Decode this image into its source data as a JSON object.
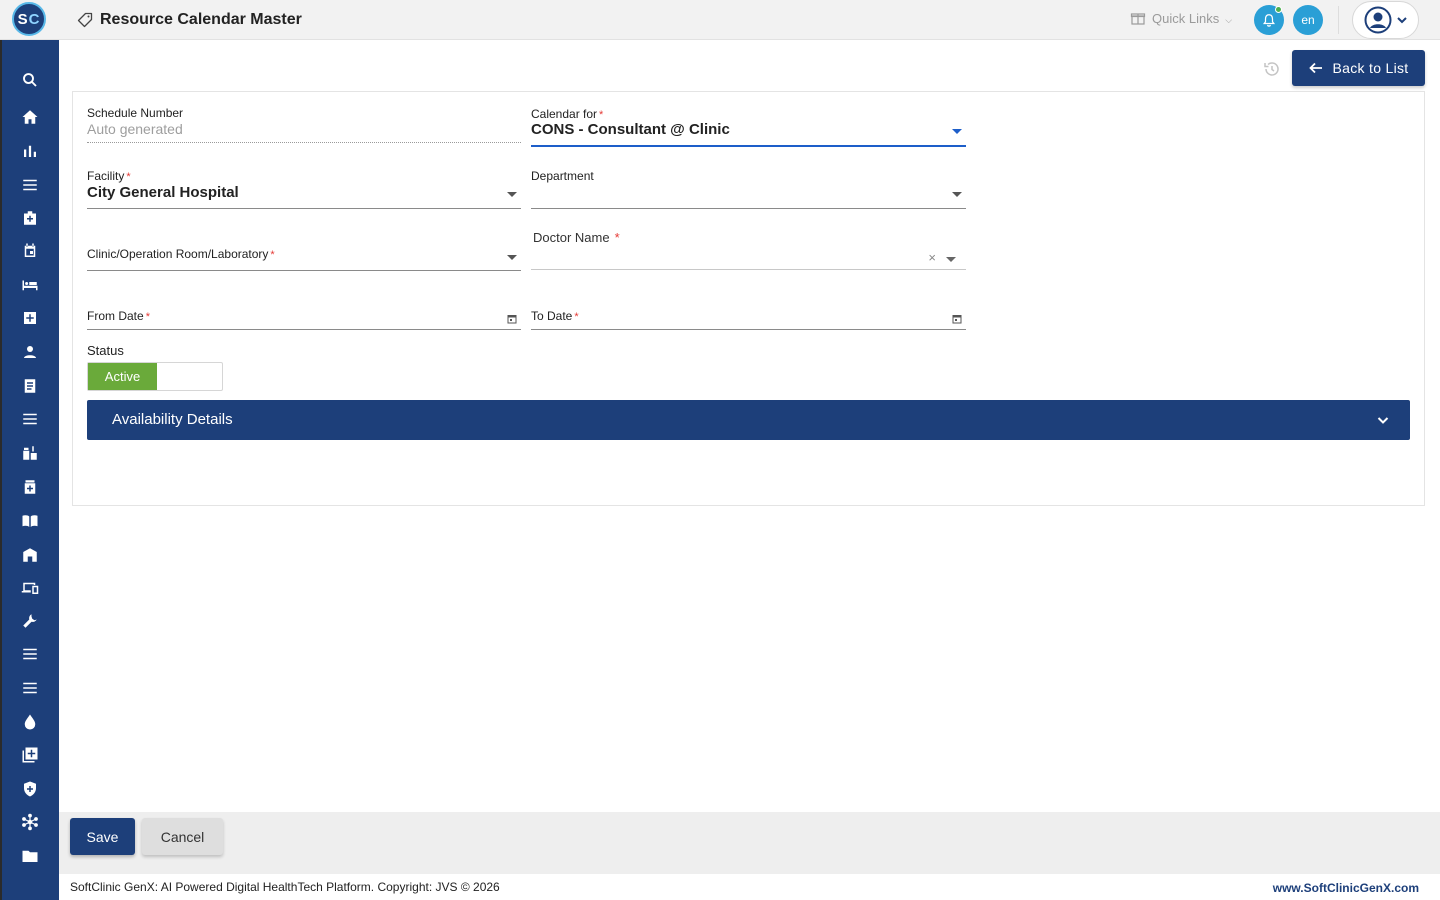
{
  "app": {
    "logo_text_s": "S",
    "logo_text_c": "C",
    "page_title": "Resource Calendar Master",
    "quick_links": "Quick Links",
    "language": "en"
  },
  "sidebar": {
    "items": [
      "search-icon",
      "home-icon",
      "bar-chart-icon",
      "menu-icon",
      "medical-bag-icon",
      "calendar-icon",
      "bed-icon",
      "medical-plus-icon",
      "person-icon",
      "receipt-icon",
      "menu-icon",
      "pharmacy-icon",
      "pill-box-icon",
      "book-icon",
      "store-icon",
      "devices-icon",
      "wrench-icon",
      "menu-icon",
      "menu-icon",
      "blood-drop-icon",
      "library-add-icon",
      "shield-icon",
      "network-icon",
      "folder-icon"
    ]
  },
  "toolbar": {
    "back_label": "Back to List"
  },
  "form": {
    "schedule_number": {
      "label": "Schedule Number",
      "value": "Auto generated"
    },
    "calendar_for": {
      "label": "Calendar for",
      "value": "CONS - Consultant @ Clinic"
    },
    "facility": {
      "label": "Facility",
      "value": "City General Hospital"
    },
    "department": {
      "label": "Department",
      "value": ""
    },
    "clinic": {
      "label": "Clinic/Operation Room/Laboratory",
      "value": ""
    },
    "doctor": {
      "label": "Doctor Name",
      "value": ""
    },
    "from_date": {
      "label": "From Date",
      "value": ""
    },
    "to_date": {
      "label": "To Date",
      "value": ""
    },
    "required_mark": "*",
    "clear_mark": "×",
    "status": {
      "label": "Status",
      "value": "Active"
    },
    "availability": "Availability Details"
  },
  "actions": {
    "save": "Save",
    "cancel": "Cancel"
  },
  "footer": {
    "copyright": "SoftClinic GenX: AI Powered Digital HealthTech Platform. Copyright: JVS © 2026",
    "url": "www.SoftClinicGenX.com"
  },
  "colors": {
    "primary": "#1d3f7a",
    "accent": "#2a9fd6",
    "active": "#6aaa3a",
    "required": "#e53935"
  }
}
